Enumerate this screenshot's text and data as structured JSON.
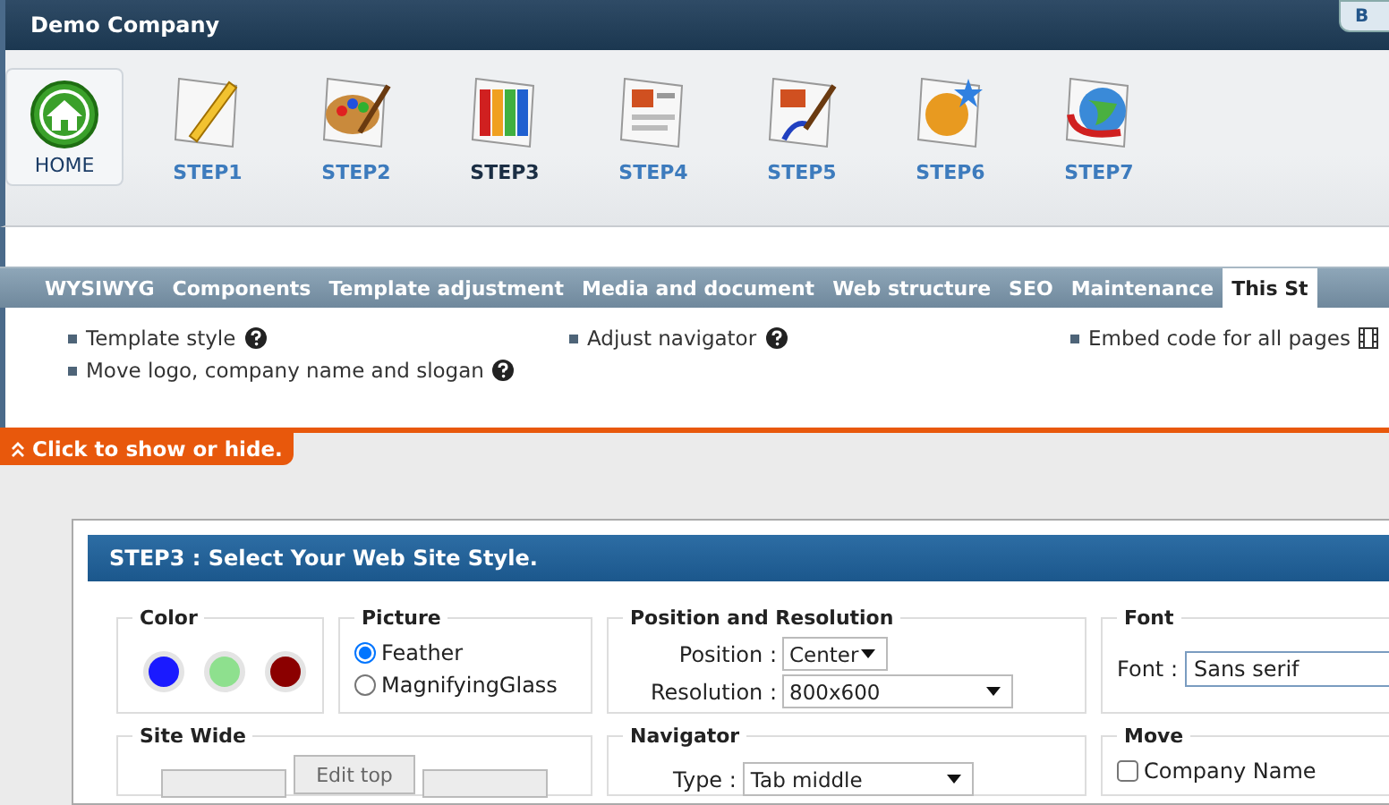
{
  "window": {
    "title": "Demo Company",
    "corner_button": "B"
  },
  "steps": [
    {
      "label": "HOME",
      "kind": "home",
      "selected": false
    },
    {
      "label": "STEP1",
      "kind": "pencil",
      "selected": false
    },
    {
      "label": "STEP2",
      "kind": "palette",
      "selected": false
    },
    {
      "label": "STEP3",
      "kind": "swatches",
      "selected": true
    },
    {
      "label": "STEP4",
      "kind": "document",
      "selected": false
    },
    {
      "label": "STEP5",
      "kind": "brush",
      "selected": false
    },
    {
      "label": "STEP6",
      "kind": "stars",
      "selected": false
    },
    {
      "label": "STEP7",
      "kind": "globe",
      "selected": false
    }
  ],
  "menu": [
    {
      "label": "WYSIWYG",
      "selected": false
    },
    {
      "label": "Components",
      "selected": false
    },
    {
      "label": "Template adjustment",
      "selected": false
    },
    {
      "label": "Media and document",
      "selected": false
    },
    {
      "label": "Web structure",
      "selected": false
    },
    {
      "label": "SEO",
      "selected": false
    },
    {
      "label": "Maintenance",
      "selected": false
    },
    {
      "label": "This St",
      "selected": true
    }
  ],
  "links": [
    [
      {
        "label": "Template style",
        "kind": "help"
      },
      {
        "label": "Move logo, company name and slogan",
        "kind": "help"
      }
    ],
    [
      {
        "label": "Adjust navigator",
        "kind": "help"
      }
    ],
    [
      {
        "label": "Embed code for all pages",
        "kind": "film"
      }
    ]
  ],
  "toggle": {
    "label": "Click to show or hide."
  },
  "dialog": {
    "title": "STEP3 : Select Your Web Site Style.",
    "color": {
      "legend": "Color",
      "swatches": [
        {
          "color": "#1a1aff"
        },
        {
          "color": "#8ee08e"
        },
        {
          "color": "#8b0000"
        }
      ]
    },
    "picture": {
      "legend": "Picture",
      "options": [
        {
          "label": "Feather",
          "selected": true
        },
        {
          "label": "MagnifyingGlass",
          "selected": false
        }
      ]
    },
    "position": {
      "legend": "Position and Resolution",
      "fields": [
        {
          "label": "Position :",
          "value": "Center",
          "wide": false
        },
        {
          "label": "Resolution :",
          "value": "800x600",
          "wide": true
        }
      ]
    },
    "font": {
      "legend": "Font",
      "label": "Font :",
      "value": "Sans serif"
    },
    "site_wide": {
      "legend": "Site Wide",
      "button": "Edit top"
    },
    "navigator": {
      "legend": "Navigator",
      "label": "Type :",
      "value": "Tab middle"
    },
    "move": {
      "legend": "Move",
      "options": [
        {
          "label": "Company Name",
          "checked": false
        }
      ]
    }
  }
}
